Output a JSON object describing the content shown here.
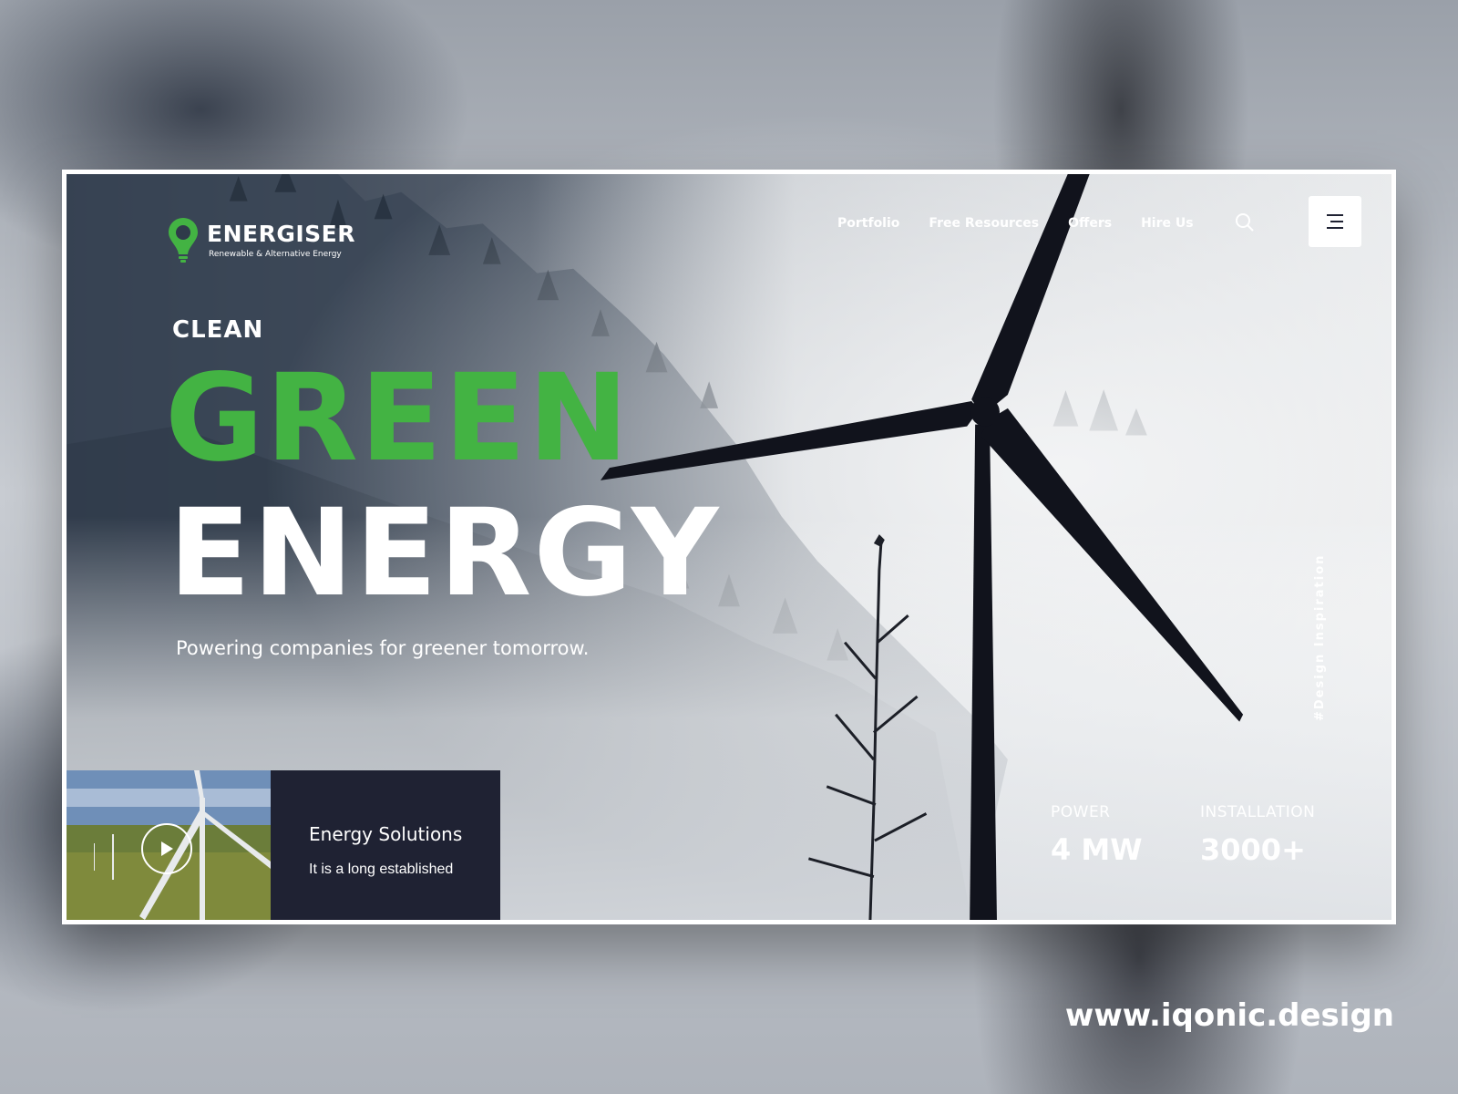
{
  "brand": {
    "name": "ENERGISER",
    "tagline": "Renewable & Alternative Energy",
    "accent_color": "#43b343",
    "icon": "lightbulb-pin-icon"
  },
  "nav": {
    "items": [
      {
        "label": "Portfolio"
      },
      {
        "label": "Free Resources"
      },
      {
        "label": "Offers"
      },
      {
        "label": "Hire Us"
      }
    ],
    "search_icon": "search-icon",
    "menu_icon": "hamburger-menu-icon"
  },
  "hero": {
    "eyebrow": "CLEAN",
    "title_green": "GREEN",
    "title_white": "ENERGY",
    "subtitle": "Powering companies for greener tomorrow."
  },
  "video_card": {
    "icon": "play-icon",
    "title": "Energy Solutions",
    "text": "It is a long established",
    "panel_color": "#1f2233"
  },
  "stats": [
    {
      "label": "POWER",
      "value": "4 MW"
    },
    {
      "label": "INSTALLATION",
      "value": "3000+"
    }
  ],
  "side_tag": "#Design Inspiration",
  "footer": {
    "url": "www.iqonic.design"
  }
}
